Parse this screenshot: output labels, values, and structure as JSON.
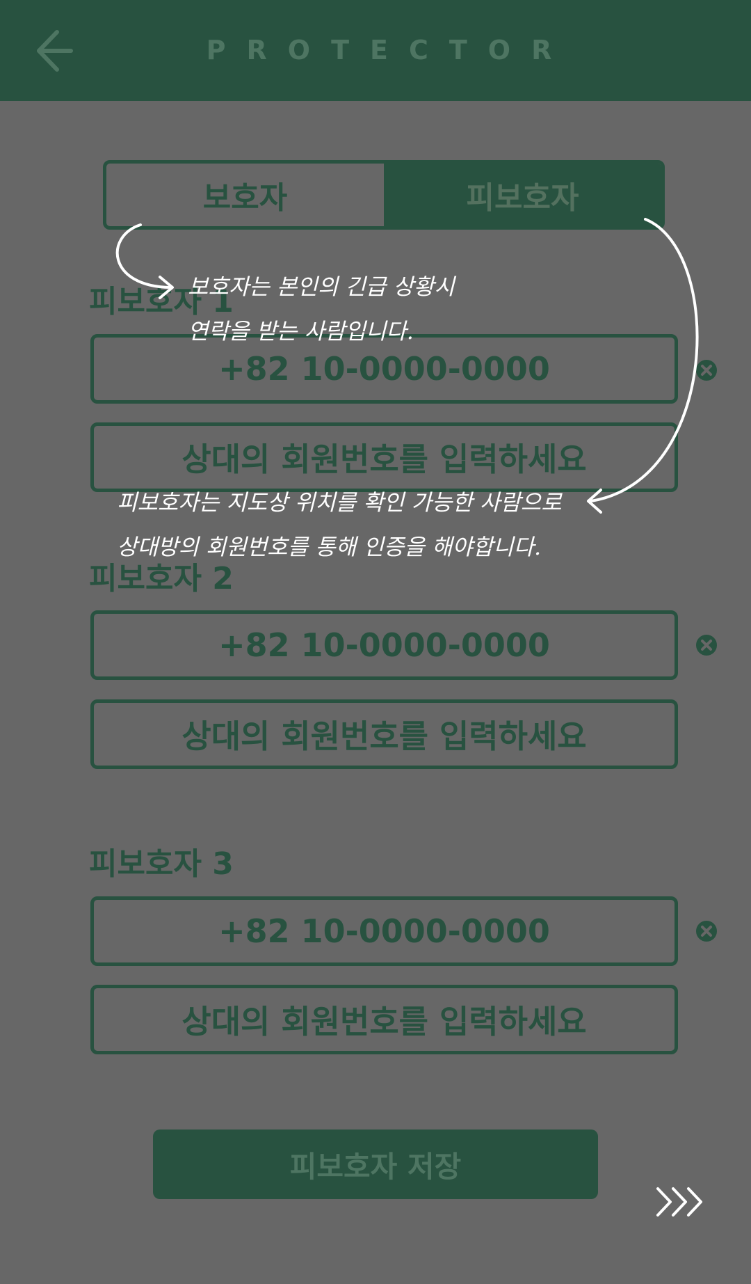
{
  "header": {
    "title": "PROTECTOR"
  },
  "tabs": [
    {
      "label": "보호자",
      "active": false
    },
    {
      "label": "피보호자",
      "active": true
    }
  ],
  "wards": [
    {
      "label": "피보호자 1",
      "phone": "+82 10-0000-0000",
      "member_placeholder": "상대의 회원번호를 입력하세요"
    },
    {
      "label": "피보호자 2",
      "phone": "+82 10-0000-0000",
      "member_placeholder": "상대의 회원번호를 입력하세요"
    },
    {
      "label": "피보호자 3",
      "phone": "+82 10-0000-0000",
      "member_placeholder": "상대의 회원번호를 입력하세요"
    }
  ],
  "save_button": {
    "label": "피보호자 저장"
  },
  "annotations": {
    "guardian_line1": "보호자는 본인의 긴급 상황시",
    "guardian_line2": "연락을 받는 사람입니다.",
    "ward_line1": "피보호자는 지도상 위치를 확인 가능한 사람으로",
    "ward_line2": "상대방의 회원번호를 통해 인증을 해야합니다."
  },
  "icons": {
    "back": "back-arrow-icon",
    "clear": "close-circle-icon",
    "next": "chevron-triple-right-icon"
  },
  "colors": {
    "primary": "#285240",
    "overlay": "#676767",
    "annotation": "#ffffff"
  }
}
